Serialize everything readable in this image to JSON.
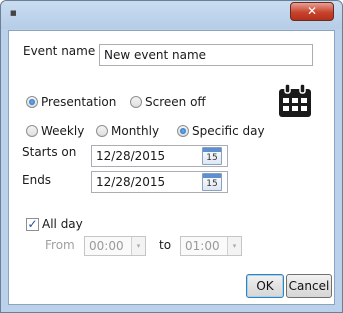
{
  "window": {
    "app_icon_glyph": "■",
    "close_glyph": "✕"
  },
  "event_name": {
    "label": "Event name",
    "value": "New event name"
  },
  "display_mode": {
    "options": [
      "Presentation",
      "Screen off"
    ],
    "selected": "Presentation"
  },
  "recurrence": {
    "options": [
      "Weekly",
      "Monthly",
      "Specific day"
    ],
    "selected": "Specific day"
  },
  "dates": {
    "starts_on_label": "Starts on",
    "starts_on_value": "12/28/2015",
    "ends_label": "Ends",
    "ends_value": "12/28/2015",
    "calendar_icon_number": "15"
  },
  "all_day": {
    "label": "All day",
    "checked": true
  },
  "time_range": {
    "from_label": "From",
    "from_value": "00:00",
    "to_label": "to",
    "to_value": "01:00",
    "spin_glyph": "▾"
  },
  "buttons": {
    "ok": "OK",
    "cancel": "Cancel"
  },
  "colors": {
    "titlebar": "#b9d1ea",
    "close_button": "#c7432c",
    "radio_selected": "#1e62b8",
    "calendar_icon": "#1a1a1a"
  },
  "icons": {
    "calendar_large": "calendar-icon",
    "close": "close-icon"
  }
}
